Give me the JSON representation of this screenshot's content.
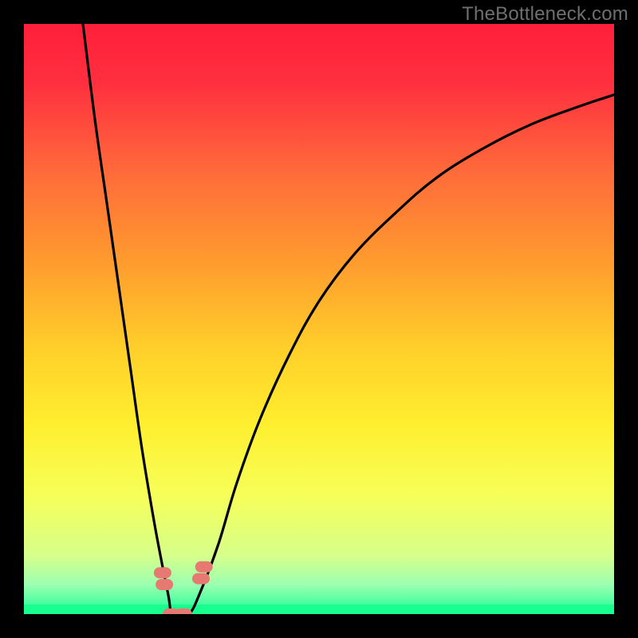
{
  "watermark": "TheBottleneck.com",
  "chart_data": {
    "type": "line",
    "title": "",
    "xlabel": "",
    "ylabel": "",
    "xlim": [
      0,
      100
    ],
    "ylim": [
      0,
      100
    ],
    "grid": false,
    "series": [
      {
        "name": "left-curve",
        "x": [
          10,
          12,
          14,
          16,
          18,
          20,
          22,
          23.5,
          24.5,
          25,
          26
        ],
        "y": [
          100,
          84,
          70,
          56,
          42,
          28,
          16,
          8,
          3,
          0,
          0
        ]
      },
      {
        "name": "right-curve",
        "x": [
          26,
          28,
          30,
          33,
          36,
          40,
          45,
          50,
          56,
          63,
          70,
          78,
          86,
          94,
          100
        ],
        "y": [
          0,
          0,
          4,
          12,
          22,
          33,
          44,
          53,
          61,
          68,
          74,
          79,
          83,
          86,
          88
        ]
      }
    ],
    "markers": [
      {
        "name": "marker-left-1",
        "x": 23.5,
        "y": 7
      },
      {
        "name": "marker-left-2",
        "x": 23.8,
        "y": 5
      },
      {
        "name": "marker-floor-1",
        "x": 25.0,
        "y": 0
      },
      {
        "name": "marker-floor-2",
        "x": 27.0,
        "y": 0
      },
      {
        "name": "marker-right-1",
        "x": 30.0,
        "y": 6
      },
      {
        "name": "marker-right-2",
        "x": 30.5,
        "y": 8
      }
    ],
    "background_gradient": {
      "stops": [
        {
          "offset": 0.0,
          "color": "#ff1f3a"
        },
        {
          "offset": 0.1,
          "color": "#ff2f3f"
        },
        {
          "offset": 0.25,
          "color": "#ff6a3a"
        },
        {
          "offset": 0.4,
          "color": "#ff9a2e"
        },
        {
          "offset": 0.55,
          "color": "#ffcf2a"
        },
        {
          "offset": 0.68,
          "color": "#ffef2f"
        },
        {
          "offset": 0.8,
          "color": "#f6ff59"
        },
        {
          "offset": 0.9,
          "color": "#d7ff8a"
        },
        {
          "offset": 0.95,
          "color": "#9cffb0"
        },
        {
          "offset": 0.98,
          "color": "#4effa0"
        },
        {
          "offset": 1.0,
          "color": "#18ff92"
        }
      ]
    },
    "floor_band_color": "#18ff8f",
    "marker_fill": "#e67a72",
    "curve_stroke": "#000000"
  }
}
